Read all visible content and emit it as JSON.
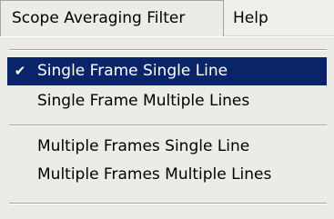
{
  "menubar": {
    "items": [
      {
        "label": "Scope Averaging Filter",
        "open": true
      },
      {
        "label": "Help",
        "open": false
      }
    ]
  },
  "dropdown": {
    "items": [
      {
        "label": "Single Frame Single Line",
        "checked": true,
        "highlighted": true
      },
      {
        "label": "Single Frame Multiple Lines",
        "checked": false,
        "highlighted": false
      },
      {
        "label": "Multiple Frames Single Line",
        "checked": false,
        "highlighted": false
      },
      {
        "label": "Multiple Frames Multiple Lines",
        "checked": false,
        "highlighted": false
      }
    ],
    "check_glyph": "✔"
  },
  "colors": {
    "menu_background": "#ecebe6",
    "highlight_background": "#0a246a",
    "highlight_text": "#ffffff",
    "separator": "#a8a59c"
  }
}
